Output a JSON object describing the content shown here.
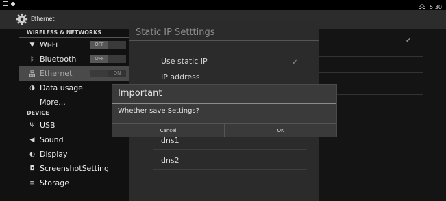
{
  "status_bar": {
    "time": "5:30",
    "icons": [
      "screenshot-icon",
      "notification-dot-icon",
      "ethernet-status-icon"
    ]
  },
  "action_bar": {
    "title": "Ethernet",
    "icon": "gear-icon"
  },
  "sidebar": {
    "header_wireless": "WIRELESS & NETWORKS",
    "items_wireless": [
      {
        "label": "Wi-Fi",
        "icon": "wifi-icon",
        "toggle": "OFF"
      },
      {
        "label": "Bluetooth",
        "icon": "bluetooth-icon",
        "toggle": "OFF"
      },
      {
        "label": "Ethernet",
        "icon": "ethernet-icon",
        "toggle": "ON"
      },
      {
        "label": "Data usage",
        "icon": "data-usage-icon"
      },
      {
        "label": "More..."
      }
    ],
    "header_device": "DEVICE",
    "items_device": [
      {
        "label": "USB",
        "icon": "usb-icon"
      },
      {
        "label": "Sound",
        "icon": "sound-icon"
      },
      {
        "label": "Display",
        "icon": "display-icon"
      },
      {
        "label": "ScreenshotSetting",
        "icon": "camera-icon"
      },
      {
        "label": "Storage",
        "icon": "storage-icon"
      }
    ]
  },
  "static_dialog": {
    "title": "Static IP Setttings",
    "rows": [
      "Use static IP",
      "IP address",
      "dns1",
      "dns2"
    ]
  },
  "important_dialog": {
    "title": "Important",
    "message": "Whether save Settings?",
    "cancel_label": "Cancel",
    "ok_label": "OK"
  }
}
